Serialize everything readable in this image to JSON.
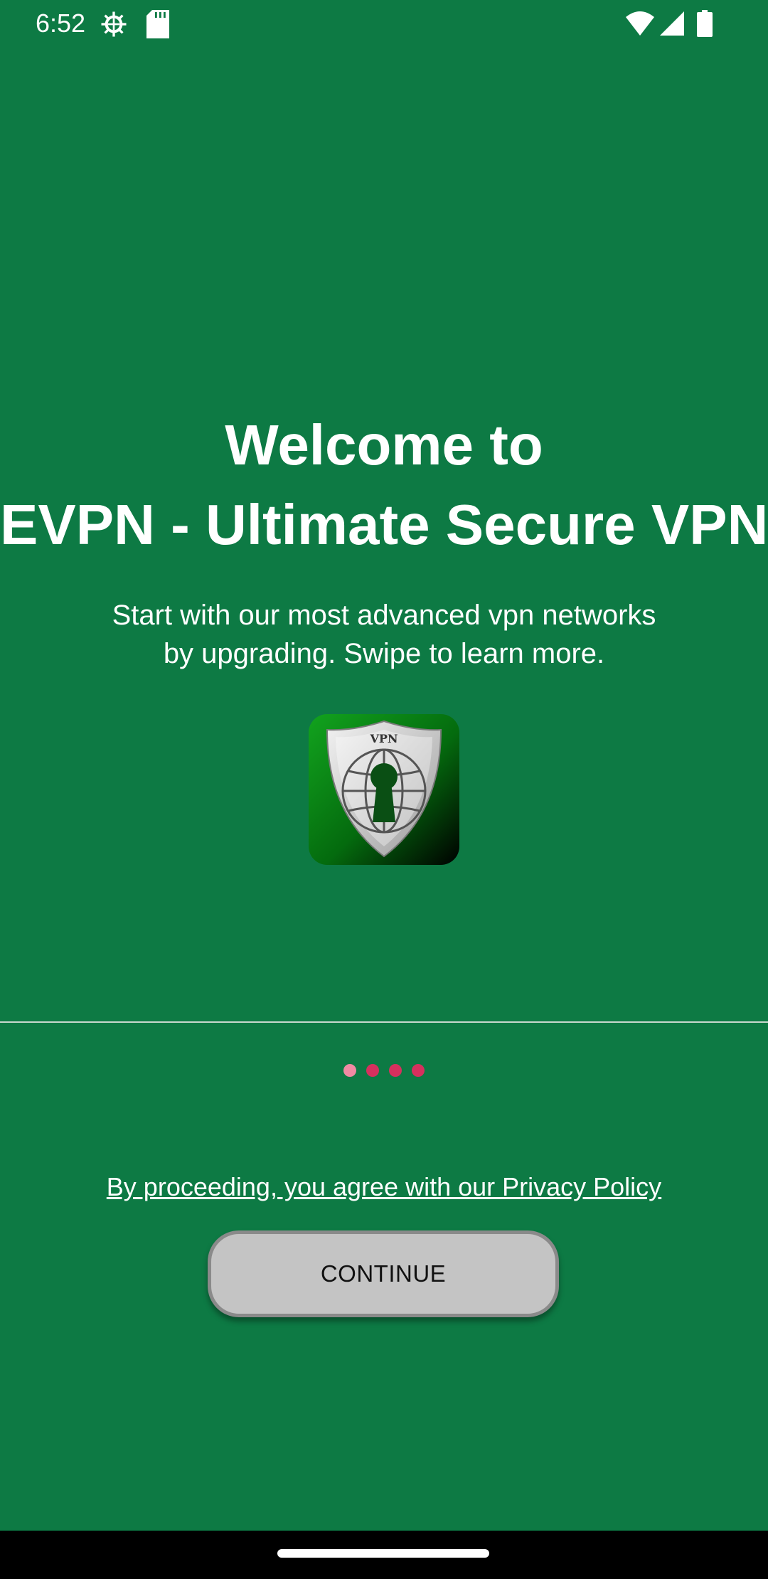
{
  "status_bar": {
    "time": "6:52",
    "icons": [
      "settings-gear-icon",
      "sd-card-icon",
      "wifi-icon",
      "cellular-signal-icon",
      "battery-icon"
    ]
  },
  "welcome": {
    "title_line1": "Welcome to",
    "title_line2": "EVPN - Ultimate Secure VPN",
    "subtitle_line1": "Start with our most advanced vpn networks",
    "subtitle_line2": "by upgrading. Swipe to learn more."
  },
  "logo": {
    "badge_text": "VPN",
    "icon": "vpn-shield-keyhole-icon"
  },
  "pager": {
    "count": 4,
    "active_index": 0
  },
  "footer": {
    "privacy_text": "By proceeding, you agree with our Privacy Policy",
    "continue_label": "CONTINUE"
  },
  "colors": {
    "background": "#0d7a44",
    "dot": "#d6305e",
    "dot_active": "#f08aa3",
    "button_bg": "#c4c4c4"
  }
}
